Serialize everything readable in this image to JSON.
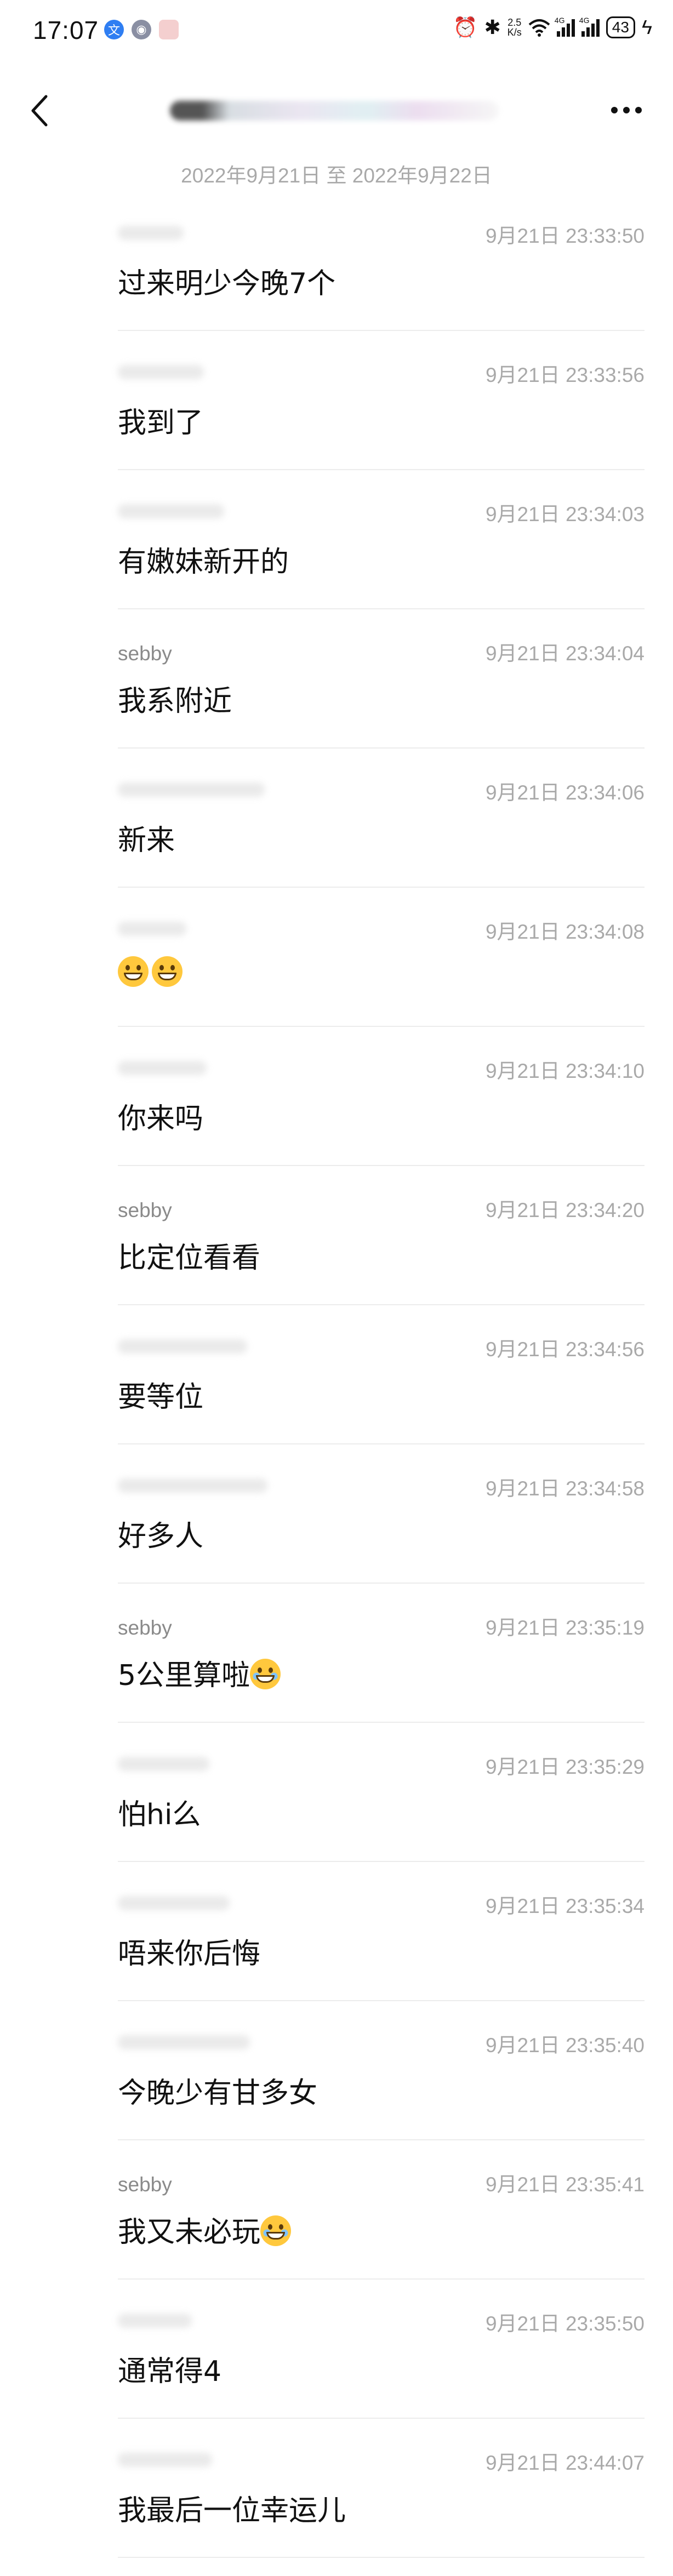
{
  "status_bar": {
    "time": "17:07",
    "speed": "2.5",
    "speed_unit": "K/s",
    "network_1": "4G",
    "network_2": "4G",
    "battery": "43"
  },
  "header": {
    "back_icon": "chevron-left-icon",
    "more_icon": "more-horizontal-icon"
  },
  "date_range": "2022年9月21日 至 2022年9月22日",
  "messages": [
    {
      "sender": "",
      "time": "9月21日 23:33:50",
      "text": "过来明少今晚7个",
      "emoji": ""
    },
    {
      "sender": "",
      "time": "9月21日 23:33:56",
      "text": "我到了",
      "emoji": ""
    },
    {
      "sender": "",
      "time": "9月21日 23:34:03",
      "text": "有嫩妹新开的",
      "emoji": ""
    },
    {
      "sender": "sebby",
      "time": "9月21日 23:34:04",
      "text": "我系附近",
      "emoji": ""
    },
    {
      "sender": "",
      "time": "9月21日 23:34:06",
      "text": "新来",
      "emoji": ""
    },
    {
      "sender": "",
      "time": "9月21日 23:34:08",
      "text": "",
      "emoji": "grin-grin"
    },
    {
      "sender": "",
      "time": "9月21日 23:34:10",
      "text": "你来吗",
      "emoji": ""
    },
    {
      "sender": "sebby",
      "time": "9月21日 23:34:20",
      "text": "比定位看看",
      "emoji": ""
    },
    {
      "sender": "",
      "time": "9月21日 23:34:56",
      "text": "要等位",
      "emoji": ""
    },
    {
      "sender": "",
      "time": "9月21日 23:34:58",
      "text": "好多人",
      "emoji": ""
    },
    {
      "sender": "sebby",
      "time": "9月21日 23:35:19",
      "text": "5公里算啦",
      "emoji": "laugh-cry"
    },
    {
      "sender": "",
      "time": "9月21日 23:35:29",
      "text": "怕hi么",
      "emoji": ""
    },
    {
      "sender": "",
      "time": "9月21日 23:35:34",
      "text": "唔来你后悔",
      "emoji": ""
    },
    {
      "sender": "",
      "time": "9月21日 23:35:40",
      "text": "今晚少有甘多女",
      "emoji": ""
    },
    {
      "sender": "sebby",
      "time": "9月21日 23:35:41",
      "text": "我又未必玩",
      "emoji": "laugh-cry"
    },
    {
      "sender": "",
      "time": "9月21日 23:35:50",
      "text": "通常得4",
      "emoji": ""
    },
    {
      "sender": "",
      "time": "9月21日 23:44:07",
      "text": "我最后一位幸运儿",
      "emoji": ""
    }
  ]
}
